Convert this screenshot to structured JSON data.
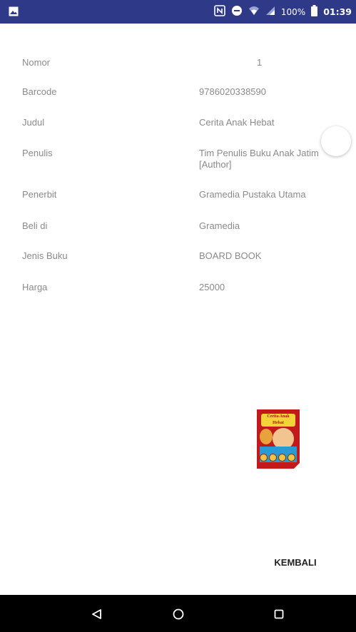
{
  "status_bar": {
    "battery_percent": "100%",
    "time": "01:39",
    "nfc_label": "N"
  },
  "details": [
    {
      "label": "Nomor",
      "value": "1"
    },
    {
      "label": "Barcode",
      "value": "9786020338590"
    },
    {
      "label": "Judul",
      "value": "Cerita Anak Hebat"
    },
    {
      "label": "Penulis",
      "value": "Tim Penulis Buku Anak Jatim [Author]"
    },
    {
      "label": "Penerbit",
      "value": "Gramedia Pustaka Utama"
    },
    {
      "label": "Beli di",
      "value": "Gramedia"
    },
    {
      "label": "Jenis Buku",
      "value": "BOARD BOOK"
    },
    {
      "label": "Harga",
      "value": "25000"
    }
  ],
  "cover": {
    "title_text": "Cerita Anak Hebat"
  },
  "actions": {
    "back_label": "KEMBALI"
  },
  "colors": {
    "status_bar": "#2e3a87",
    "text_muted": "#8a8a8a",
    "nav_bar": "#000000"
  },
  "icons": {
    "status_left": "image-icon",
    "nfc": "nfc-icon",
    "dnd": "do-not-disturb-icon",
    "wifi": "wifi-icon",
    "signal": "signal-icon",
    "battery": "battery-icon",
    "nav_back": "back-triangle-icon",
    "nav_home": "home-circle-icon",
    "nav_recent": "recent-square-icon"
  }
}
